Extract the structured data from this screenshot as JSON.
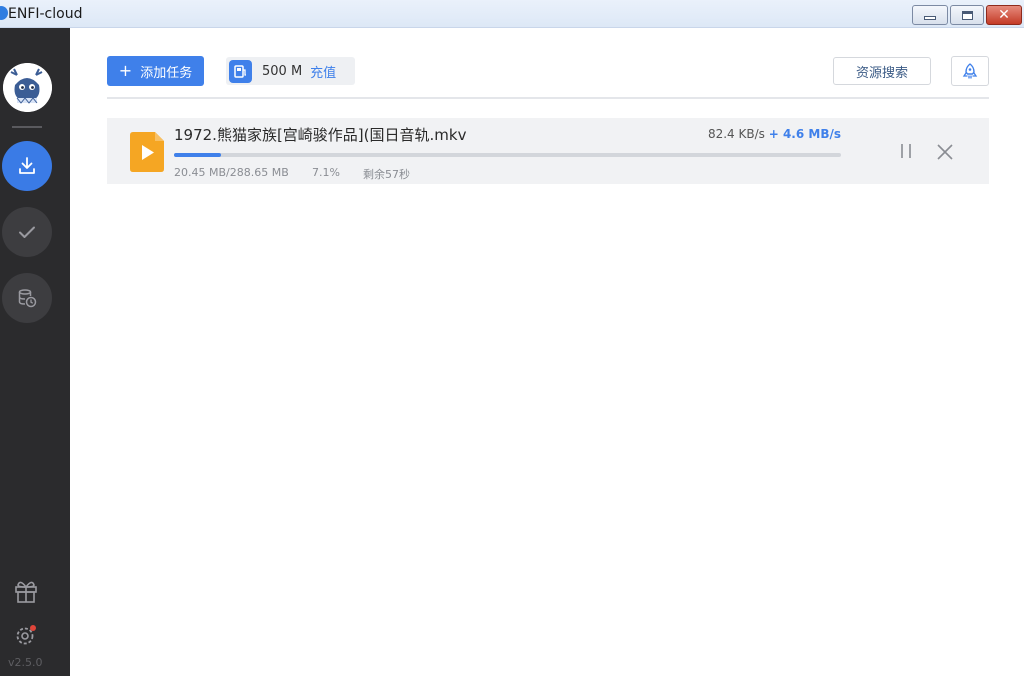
{
  "window": {
    "title": "ENFI-cloud",
    "close_glyph": "✕"
  },
  "sidebar": {
    "nav": [
      {
        "name": "downloading",
        "icon": "download-icon",
        "active": true
      },
      {
        "name": "completed",
        "icon": "check-icon",
        "active": false
      },
      {
        "name": "cloud-storage",
        "icon": "database-clock-icon",
        "active": false
      }
    ],
    "bottom_icons": [
      "gift-icon",
      "gear-icon"
    ],
    "version": "v2.5.0",
    "colors": {
      "background": "#2b2b2d",
      "active": "#3a7be6"
    }
  },
  "toolbar": {
    "add_task_plus": "+",
    "add_task_label": "添加任务",
    "quota_amount": "500 M",
    "quota_recharge": "充值",
    "resource_search_label": "资源搜索",
    "rocket_icon": "rocket-icon"
  },
  "task": {
    "file_name": "1972.熊猫家族[宫崎骏作品](国日音轨.mkv",
    "speed": "82.4 KB/s",
    "boost": "+ 4.6 MB/s",
    "size_progress": "20.45 MB/288.65 MB",
    "percent": "7.1%",
    "progress_fraction": 0.071,
    "remaining": "剩余57秒",
    "file_icon": "video-file-icon",
    "pause_icon": "pause-icon",
    "cancel_icon": "close-icon"
  },
  "accent_color": "#3f80ea"
}
